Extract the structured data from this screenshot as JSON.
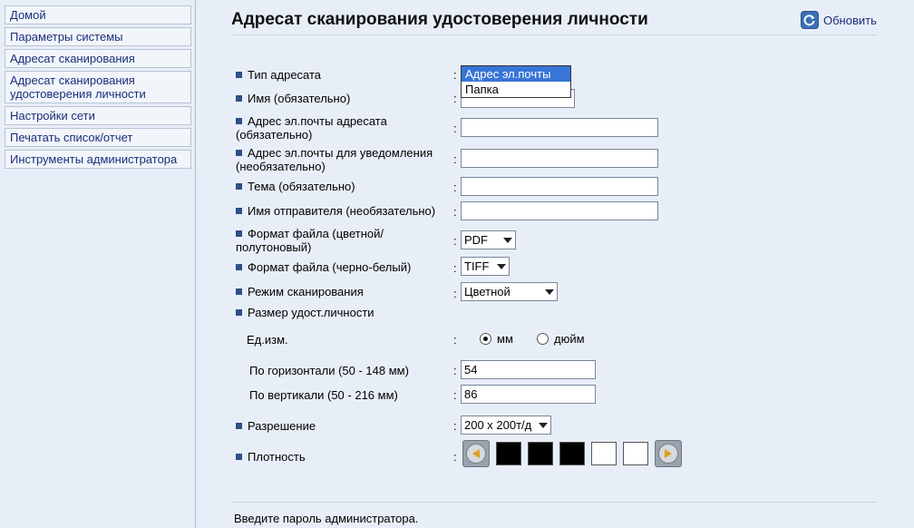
{
  "sidebar": {
    "items": [
      {
        "label": "Домой"
      },
      {
        "label": "Параметры системы"
      },
      {
        "label": "Адресат сканирования"
      },
      {
        "label": "Адресат сканирования удостоверения личности"
      },
      {
        "label": "Настройки сети"
      },
      {
        "label": "Печатать список/отчет"
      },
      {
        "label": "Инструменты администратора"
      }
    ]
  },
  "header": {
    "title": "Адресат сканирования удостоверения личности",
    "refresh_label": "Обновить"
  },
  "form": {
    "colon": ":",
    "dest_type": {
      "label": "Тип адресата",
      "options": [
        "Адрес эл.почты",
        "Папка"
      ],
      "selected": "Адрес эл.почты"
    },
    "name": {
      "label": "Имя (обязательно)",
      "value": ""
    },
    "dest_email": {
      "label": "Адрес эл.почты адресата (обязательно)",
      "value": ""
    },
    "notify_email": {
      "label": "Адрес эл.почты для уведомления (необязательно)",
      "value": ""
    },
    "subject": {
      "label": "Тема (обязательно)",
      "value": ""
    },
    "sender": {
      "label": "Имя отправителя (необязательно)",
      "value": ""
    },
    "format_color": {
      "label": "Формат файла (цветной/полутоновый)",
      "value": "PDF"
    },
    "format_bw": {
      "label": "Формат файла (черно-белый)",
      "value": "TIFF"
    },
    "scan_mode": {
      "label": "Режим сканирования",
      "value": "Цветной"
    },
    "id_size": {
      "label": "Размер удост.личности",
      "unit_label": "Ед.изм.",
      "unit_mm": "мм",
      "unit_inch": "дюйм",
      "selected_unit": "мм",
      "horizontal_label": "По горизонтали (50 - 148 мм)",
      "horizontal_value": "54",
      "vertical_label": "По вертикали (50 - 216 мм)",
      "vertical_value": "86"
    },
    "resolution": {
      "label": "Разрешение",
      "value": "200 x 200т/д"
    },
    "density": {
      "label": "Плотность",
      "levels": 5,
      "filled": 3
    }
  },
  "footer": {
    "text": "Введите пароль администратора."
  }
}
